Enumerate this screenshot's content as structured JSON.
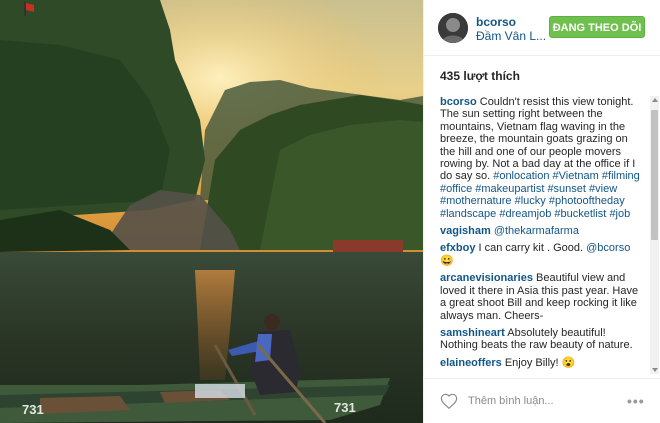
{
  "post": {
    "username": "bcorso",
    "location": "Đầm Vân L...",
    "follow_label": "ĐANG THEO DÕI",
    "likes": "435 lượt thích",
    "boat_number_left": "731",
    "boat_number_right": "731"
  },
  "caption": {
    "user": "bcorso",
    "text": "Couldn't resist this view tonight. The sun setting right between the mountains, Vietnam flag waving in the breeze, the mountain goats grazing on the hill and one of our people movers rowing by. Not a bad day at the office if I do say so. ",
    "tags": [
      "#onlocation",
      "#Vietnam",
      "#filming",
      "#office",
      "#makeupartist",
      "#sunset",
      "#view",
      "#mothernature",
      "#lucky",
      "#photooftheday",
      "#landscape",
      "#dreamjob",
      "#bucketlist",
      "#job"
    ]
  },
  "comments": [
    {
      "user": "vagisham",
      "text": "",
      "mention": "@thekarmafarma"
    },
    {
      "user": "efxboy",
      "text": "I can carry kit . Good. ",
      "mention": "@bcorso",
      "emoji": "😀"
    },
    {
      "user": "arcanevisionaries",
      "text": "Beautiful view and loved it there in Asia this past year. Have a great shoot Bill and keep rocking it like always man. Cheers-",
      "mention": ""
    },
    {
      "user": "samshineart",
      "text": "Absolutely beautiful! Nothing beats the raw beauty of nature.",
      "mention": ""
    },
    {
      "user": "elaineoffers",
      "text": "Enjoy Billy! ",
      "mention": "",
      "emoji": "😮"
    }
  ],
  "footer": {
    "add_comment_placeholder": "Thêm bình luận...",
    "more_label": "•••"
  },
  "colors": {
    "link": "#125688",
    "follow_button": "#70c050",
    "text": "#262626"
  },
  "icons": {
    "like": "heart-icon",
    "more": "more-options-icon"
  }
}
